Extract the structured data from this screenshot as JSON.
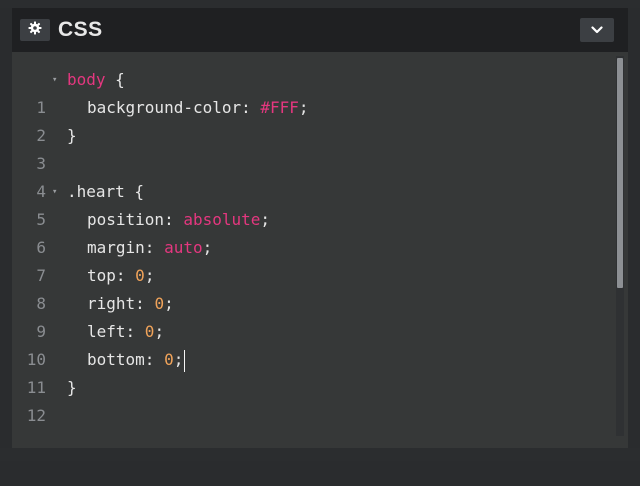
{
  "panel": {
    "title": "CSS",
    "settings_icon": "gear-icon",
    "collapse_icon": "chevron-down-icon"
  },
  "colors": {
    "selector": "#e4377f",
    "keyword_value": "#e4377f",
    "number_value": "#f0a35a",
    "text": "#e6e6e6",
    "line_number": "#8a8d91",
    "editor_bg": "#363838",
    "header_bg": "#1f2022"
  },
  "editor": {
    "lines": [
      {
        "num": "1",
        "fold": "▾",
        "selector": "body",
        "rest": " {"
      },
      {
        "num": "2",
        "prop": "background-color: ",
        "value": "#FFF",
        "end": ";"
      },
      {
        "num": "3",
        "text": "}"
      },
      {
        "num": "4",
        "text": ""
      },
      {
        "num": "5",
        "fold": "▾",
        "text": ".heart {"
      },
      {
        "num": "6",
        "prop": "position: ",
        "value": "absolute",
        "end": ";"
      },
      {
        "num": "7",
        "prop": "margin: ",
        "value": "auto",
        "end": ";"
      },
      {
        "num": "8",
        "prop": "top: ",
        "value": "0",
        "end": ";"
      },
      {
        "num": "9",
        "prop": "right: ",
        "value": "0",
        "end": ";"
      },
      {
        "num": "10",
        "prop": "left: ",
        "value": "0",
        "end": ";"
      },
      {
        "num": "11",
        "prop": "bottom: ",
        "value": "0",
        "end": ";"
      },
      {
        "num": "12",
        "text": "}"
      }
    ]
  }
}
